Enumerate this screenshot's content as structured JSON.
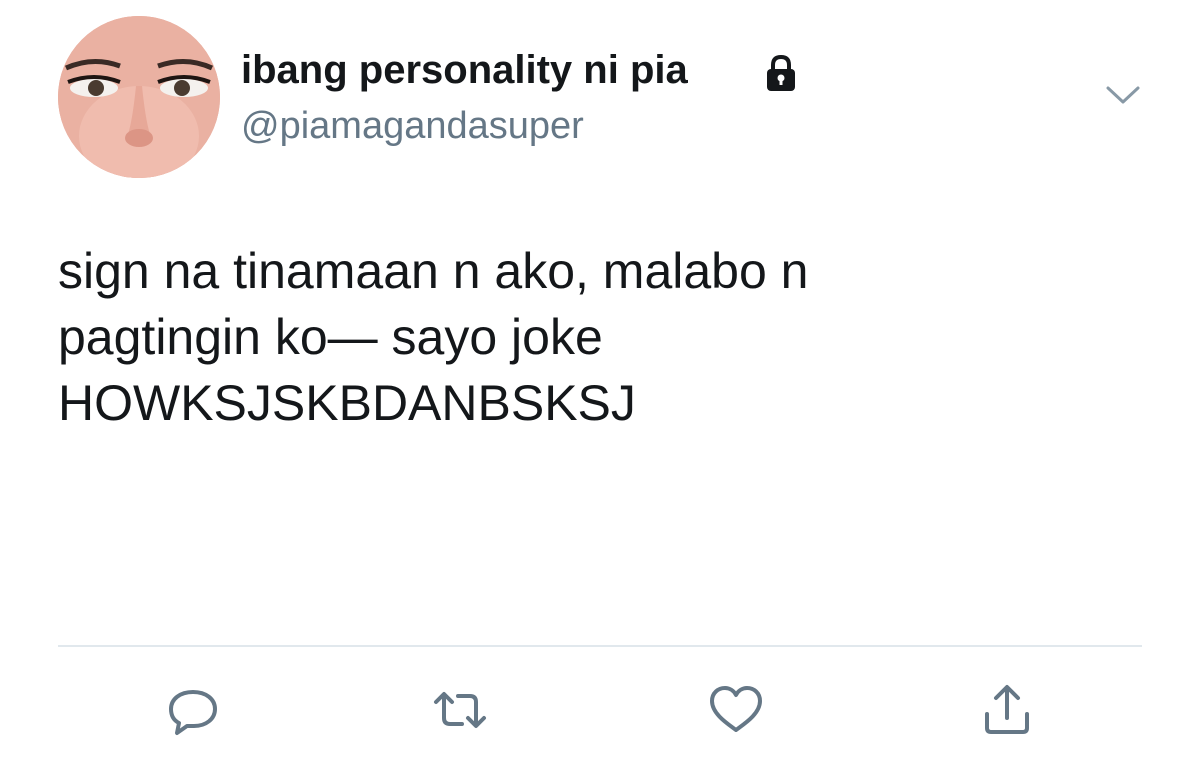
{
  "tweet": {
    "author": {
      "display_name": "ibang personality ni pia",
      "handle": "@piamagandasuper",
      "protected_icon": "lock-icon",
      "avatar": "profile-photo"
    },
    "text_lines": [
      "sign na tinamaan n ako, malabo n",
      "pagtingin ko— sayo joke",
      "HOWKSJSKBDANBSKSJ"
    ],
    "menu_icon": "chevron-down-icon",
    "actions": [
      {
        "name": "reply",
        "icon": "reply-icon"
      },
      {
        "name": "retweet",
        "icon": "retweet-icon"
      },
      {
        "name": "like",
        "icon": "heart-icon"
      },
      {
        "name": "share",
        "icon": "share-icon"
      }
    ]
  },
  "colors": {
    "text": "#14171a",
    "secondary": "#657786",
    "divider": "#e1e8ed",
    "icon": "#657786"
  }
}
